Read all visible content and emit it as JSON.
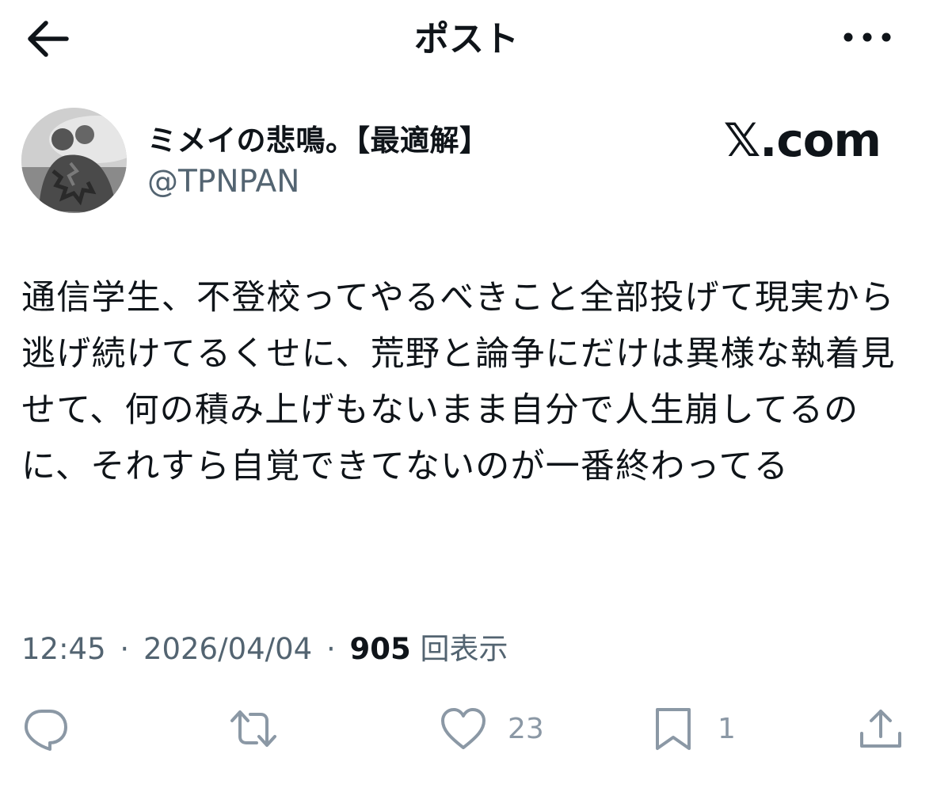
{
  "header": {
    "title": "ポスト",
    "back_icon": "arrow-left-icon",
    "more_icon": "more-horizontal-icon"
  },
  "author": {
    "display_name": "ミメイの悲鳴。【最適解】",
    "handle": "@TPNPAN",
    "avatar": "profile-photo"
  },
  "brand": "𝕏.com",
  "tweet": {
    "text": "通信学生、不登校ってやるべきこと全部投げて現実から逃げ続けてるくせに、荒野と論争にだけは異様な執着見せて、何の積み上げもないまま自分で人生崩してるのに、それすら自覚できてないのが一番終わってる"
  },
  "meta": {
    "time": "12:45",
    "date": "2026/04/04",
    "views_count": "905",
    "views_label": "回表示",
    "separator": "·"
  },
  "actions": {
    "reply": {
      "icon": "reply-icon",
      "count": ""
    },
    "repost": {
      "icon": "repost-icon",
      "count": ""
    },
    "like": {
      "icon": "heart-icon",
      "count": "23"
    },
    "bookmark": {
      "icon": "bookmark-icon",
      "count": "1"
    },
    "share": {
      "icon": "share-icon",
      "count": ""
    }
  },
  "colors": {
    "text": "#0f1419",
    "secondary": "#536471",
    "action_icon": "#8b98a5"
  }
}
